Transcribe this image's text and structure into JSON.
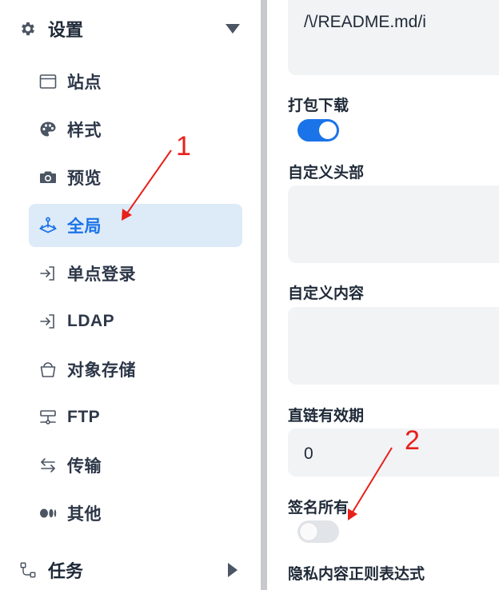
{
  "sidebar": {
    "settings_group": {
      "label": "设置",
      "icon": "gear-icon",
      "state": "expanded"
    },
    "items": [
      {
        "label": "站点",
        "icon": "window-icon"
      },
      {
        "label": "样式",
        "icon": "palette-icon"
      },
      {
        "label": "预览",
        "icon": "camera-icon"
      },
      {
        "label": "全局",
        "icon": "joystick-icon",
        "active": true
      },
      {
        "label": "单点登录",
        "icon": "login-icon"
      },
      {
        "label": "LDAP",
        "icon": "login-icon"
      },
      {
        "label": "对象存储",
        "icon": "bucket-icon"
      },
      {
        "label": "FTP",
        "icon": "server-icon"
      },
      {
        "label": "传输",
        "icon": "transfer-icon"
      },
      {
        "label": "其他",
        "icon": "medium-icon"
      }
    ],
    "tasks_group": {
      "label": "任务",
      "icon": "flow-icon",
      "state": "collapsed"
    }
  },
  "main": {
    "top_field_value": "/\\/README.md/i",
    "package_download": {
      "label": "打包下载",
      "enabled": true
    },
    "custom_head": {
      "label": "自定义头部",
      "value": ""
    },
    "custom_body": {
      "label": "自定义内容",
      "value": ""
    },
    "link_expiration": {
      "label": "直链有效期",
      "value": "0"
    },
    "sign_all": {
      "label": "签名所有",
      "enabled": false
    },
    "privacy_regex": {
      "label": "隐私内容正则表达式"
    }
  },
  "annotations": [
    {
      "number": "1",
      "target": "全局"
    },
    {
      "number": "2",
      "target": "签名所有"
    }
  ],
  "colors": {
    "accent": "#1a73e8",
    "active_bg": "#ddeaf8",
    "annotation": "#e8201a"
  }
}
